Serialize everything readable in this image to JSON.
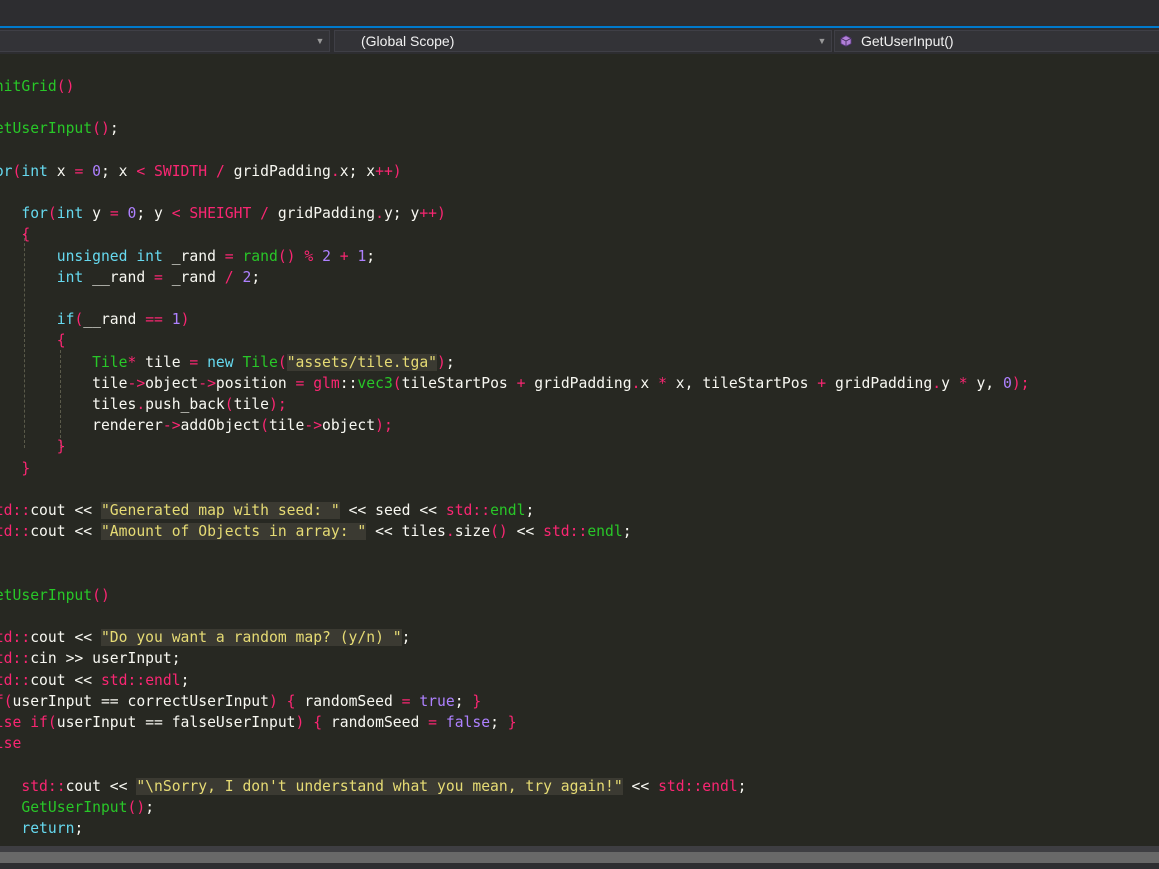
{
  "navigation": {
    "project_dropdown": "",
    "scope_dropdown": "(Global Scope)",
    "member_dropdown": "GetUserInput()",
    "member_icon": "method-cube-icon",
    "accent_color": "#007acc"
  },
  "syntax_colors": {
    "background": "#272822",
    "keyword": "#66d9ef",
    "function": "#28c728",
    "number": "#ae81ff",
    "operator": "#f92672",
    "string": "#e6db74",
    "default": "#f8f8f2"
  },
  "code": [
    {
      "tokens": [
        {
          "t": "InitGrid",
          "c": "f"
        },
        {
          "t": "()",
          "c": "o"
        }
      ]
    },
    {
      "tokens": []
    },
    {
      "tokens": [
        {
          "t": "GetUserInput",
          "c": "f"
        },
        {
          "t": "()",
          "c": "o"
        },
        {
          "t": ";",
          "c": ""
        }
      ]
    },
    {
      "tokens": []
    },
    {
      "tokens": [
        {
          "t": "for",
          "c": "k"
        },
        {
          "t": "(",
          "c": "o"
        },
        {
          "t": "int",
          "c": "k"
        },
        {
          "t": " x ",
          "c": ""
        },
        {
          "t": "=",
          "c": "o"
        },
        {
          "t": " ",
          "c": ""
        },
        {
          "t": "0",
          "c": "n"
        },
        {
          "t": "; x ",
          "c": ""
        },
        {
          "t": "<",
          "c": "o"
        },
        {
          "t": " ",
          "c": ""
        },
        {
          "t": "SWIDTH",
          "c": "o"
        },
        {
          "t": " ",
          "c": ""
        },
        {
          "t": "/",
          "c": "o"
        },
        {
          "t": " gridPadding",
          "c": ""
        },
        {
          "t": ".",
          "c": "o"
        },
        {
          "t": "x; x",
          "c": ""
        },
        {
          "t": "++)",
          "c": "o"
        }
      ]
    },
    {
      "tokens": []
    },
    {
      "tokens": [
        {
          "t": "    ",
          "c": ""
        },
        {
          "t": "for",
          "c": "k"
        },
        {
          "t": "(",
          "c": "o"
        },
        {
          "t": "int",
          "c": "k"
        },
        {
          "t": " y ",
          "c": ""
        },
        {
          "t": "=",
          "c": "o"
        },
        {
          "t": " ",
          "c": ""
        },
        {
          "t": "0",
          "c": "n"
        },
        {
          "t": "; y ",
          "c": ""
        },
        {
          "t": "<",
          "c": "o"
        },
        {
          "t": " ",
          "c": ""
        },
        {
          "t": "SHEIGHT",
          "c": "o"
        },
        {
          "t": " ",
          "c": ""
        },
        {
          "t": "/",
          "c": "o"
        },
        {
          "t": " gridPadding",
          "c": ""
        },
        {
          "t": ".",
          "c": "o"
        },
        {
          "t": "y; y",
          "c": ""
        },
        {
          "t": "++)",
          "c": "o"
        }
      ]
    },
    {
      "tokens": [
        {
          "t": "    ",
          "c": ""
        },
        {
          "t": "{",
          "c": "o"
        }
      ]
    },
    {
      "tokens": [
        {
          "t": "        ",
          "c": ""
        },
        {
          "t": "unsigned",
          "c": "k"
        },
        {
          "t": " ",
          "c": ""
        },
        {
          "t": "int",
          "c": "k"
        },
        {
          "t": " _rand ",
          "c": ""
        },
        {
          "t": "=",
          "c": "o"
        },
        {
          "t": " ",
          "c": ""
        },
        {
          "t": "rand",
          "c": "f"
        },
        {
          "t": "()",
          "c": "o"
        },
        {
          "t": " ",
          "c": ""
        },
        {
          "t": "%",
          "c": "o"
        },
        {
          "t": " ",
          "c": ""
        },
        {
          "t": "2",
          "c": "n"
        },
        {
          "t": " ",
          "c": ""
        },
        {
          "t": "+",
          "c": "o"
        },
        {
          "t": " ",
          "c": ""
        },
        {
          "t": "1",
          "c": "n"
        },
        {
          "t": ";",
          "c": ""
        }
      ]
    },
    {
      "tokens": [
        {
          "t": "        ",
          "c": ""
        },
        {
          "t": "int",
          "c": "k"
        },
        {
          "t": " __rand ",
          "c": ""
        },
        {
          "t": "=",
          "c": "o"
        },
        {
          "t": " _rand ",
          "c": ""
        },
        {
          "t": "/",
          "c": "o"
        },
        {
          "t": " ",
          "c": ""
        },
        {
          "t": "2",
          "c": "n"
        },
        {
          "t": ";",
          "c": ""
        }
      ]
    },
    {
      "tokens": []
    },
    {
      "tokens": [
        {
          "t": "        ",
          "c": ""
        },
        {
          "t": "if",
          "c": "k"
        },
        {
          "t": "(",
          "c": "o"
        },
        {
          "t": "__rand ",
          "c": ""
        },
        {
          "t": "==",
          "c": "o"
        },
        {
          "t": " ",
          "c": ""
        },
        {
          "t": "1",
          "c": "n"
        },
        {
          "t": ")",
          "c": "o"
        }
      ]
    },
    {
      "tokens": [
        {
          "t": "        ",
          "c": ""
        },
        {
          "t": "{",
          "c": "o"
        }
      ]
    },
    {
      "tokens": [
        {
          "t": "            ",
          "c": ""
        },
        {
          "t": "Tile",
          "c": "f"
        },
        {
          "t": "*",
          "c": "o"
        },
        {
          "t": " tile ",
          "c": ""
        },
        {
          "t": "=",
          "c": "o"
        },
        {
          "t": " ",
          "c": ""
        },
        {
          "t": "new",
          "c": "k"
        },
        {
          "t": " ",
          "c": ""
        },
        {
          "t": "Tile",
          "c": "f"
        },
        {
          "t": "(",
          "c": "o"
        },
        {
          "t": "\"assets/tile.tga\"",
          "c": "s"
        },
        {
          "t": ")",
          "c": "o"
        },
        {
          "t": ";",
          "c": ""
        }
      ]
    },
    {
      "tokens": [
        {
          "t": "            tile",
          "c": ""
        },
        {
          "t": "->",
          "c": "o"
        },
        {
          "t": "object",
          "c": ""
        },
        {
          "t": "->",
          "c": "o"
        },
        {
          "t": "position ",
          "c": ""
        },
        {
          "t": "=",
          "c": "o"
        },
        {
          "t": " ",
          "c": ""
        },
        {
          "t": "glm",
          "c": "o"
        },
        {
          "t": "::",
          "c": ""
        },
        {
          "t": "vec3",
          "c": "f"
        },
        {
          "t": "(",
          "c": "o"
        },
        {
          "t": "tileStartPos ",
          "c": ""
        },
        {
          "t": "+",
          "c": "o"
        },
        {
          "t": " gridPadding",
          "c": ""
        },
        {
          "t": ".",
          "c": "o"
        },
        {
          "t": "x ",
          "c": ""
        },
        {
          "t": "*",
          "c": "o"
        },
        {
          "t": " x, tileStartPos ",
          "c": ""
        },
        {
          "t": "+",
          "c": "o"
        },
        {
          "t": " gridPadding",
          "c": ""
        },
        {
          "t": ".",
          "c": "o"
        },
        {
          "t": "y ",
          "c": ""
        },
        {
          "t": "*",
          "c": "o"
        },
        {
          "t": " y, ",
          "c": ""
        },
        {
          "t": "0",
          "c": "n"
        },
        {
          "t": ");",
          "c": "o"
        }
      ]
    },
    {
      "tokens": [
        {
          "t": "            tiles",
          "c": ""
        },
        {
          "t": ".",
          "c": "o"
        },
        {
          "t": "push_back",
          "c": ""
        },
        {
          "t": "(",
          "c": "o"
        },
        {
          "t": "tile",
          "c": ""
        },
        {
          "t": ");",
          "c": "o"
        }
      ]
    },
    {
      "tokens": [
        {
          "t": "            renderer",
          "c": ""
        },
        {
          "t": "->",
          "c": "o"
        },
        {
          "t": "addObject",
          "c": ""
        },
        {
          "t": "(",
          "c": "o"
        },
        {
          "t": "tile",
          "c": ""
        },
        {
          "t": "->",
          "c": "o"
        },
        {
          "t": "object",
          "c": ""
        },
        {
          "t": ");",
          "c": "o"
        }
      ]
    },
    {
      "tokens": [
        {
          "t": "        ",
          "c": ""
        },
        {
          "t": "}",
          "c": "o"
        }
      ]
    },
    {
      "tokens": [
        {
          "t": "    ",
          "c": ""
        },
        {
          "t": "}",
          "c": "o"
        }
      ]
    },
    {
      "tokens": []
    },
    {
      "tokens": [
        {
          "t": "std",
          "c": "o"
        },
        {
          "t": "::",
          "c": "o"
        },
        {
          "t": "cout ",
          "c": ""
        },
        {
          "t": "<<",
          "c": ""
        },
        {
          "t": " ",
          "c": ""
        },
        {
          "t": "\"Generated map with seed: \"",
          "c": "s"
        },
        {
          "t": " << seed << ",
          "c": ""
        },
        {
          "t": "std",
          "c": "o"
        },
        {
          "t": "::",
          "c": "o"
        },
        {
          "t": "endl",
          "c": "f"
        },
        {
          "t": ";",
          "c": ""
        }
      ]
    },
    {
      "tokens": [
        {
          "t": "std",
          "c": "o"
        },
        {
          "t": "::",
          "c": "o"
        },
        {
          "t": "cout ",
          "c": ""
        },
        {
          "t": "<<",
          "c": ""
        },
        {
          "t": " ",
          "c": ""
        },
        {
          "t": "\"Amount of Objects in array: \"",
          "c": "s"
        },
        {
          "t": " << tiles",
          "c": ""
        },
        {
          "t": ".",
          "c": "o"
        },
        {
          "t": "size",
          "c": ""
        },
        {
          "t": "()",
          "c": "o"
        },
        {
          "t": " << ",
          "c": ""
        },
        {
          "t": "std",
          "c": "o"
        },
        {
          "t": "::",
          "c": "o"
        },
        {
          "t": "endl",
          "c": "f"
        },
        {
          "t": ";",
          "c": ""
        }
      ]
    },
    {
      "tokens": []
    },
    {
      "tokens": []
    },
    {
      "tokens": [
        {
          "t": "GetUserInput",
          "c": "f"
        },
        {
          "t": "()",
          "c": "o"
        }
      ]
    },
    {
      "tokens": []
    },
    {
      "tokens": [
        {
          "t": "std",
          "c": "o"
        },
        {
          "t": "::",
          "c": "o"
        },
        {
          "t": "cout ",
          "c": ""
        },
        {
          "t": "<<",
          "c": ""
        },
        {
          "t": " ",
          "c": ""
        },
        {
          "t": "\"Do you want a random map? (y/n) \"",
          "c": "s"
        },
        {
          "t": ";",
          "c": ""
        }
      ]
    },
    {
      "tokens": [
        {
          "t": "std",
          "c": "o"
        },
        {
          "t": "::",
          "c": "o"
        },
        {
          "t": "cin >> userInput;",
          "c": ""
        }
      ]
    },
    {
      "tokens": [
        {
          "t": "std",
          "c": "o"
        },
        {
          "t": "::",
          "c": "o"
        },
        {
          "t": "cout << ",
          "c": ""
        },
        {
          "t": "std",
          "c": "o"
        },
        {
          "t": "::",
          "c": "o"
        },
        {
          "t": "endl",
          "c": "o"
        },
        {
          "t": ";",
          "c": ""
        }
      ]
    },
    {
      "tokens": [
        {
          "t": "if",
          "c": "o"
        },
        {
          "t": "(",
          "c": "o"
        },
        {
          "t": "userInput ",
          "c": ""
        },
        {
          "t": "==",
          "c": ""
        },
        {
          "t": " correctUserInput",
          "c": ""
        },
        {
          "t": ")",
          "c": "o"
        },
        {
          "t": " ",
          "c": ""
        },
        {
          "t": "{",
          "c": "o"
        },
        {
          "t": " randomSeed ",
          "c": ""
        },
        {
          "t": "=",
          "c": "o"
        },
        {
          "t": " ",
          "c": ""
        },
        {
          "t": "true",
          "c": "n"
        },
        {
          "t": "; ",
          "c": ""
        },
        {
          "t": "}",
          "c": "o"
        }
      ]
    },
    {
      "tokens": [
        {
          "t": "else",
          "c": "o"
        },
        {
          "t": " ",
          "c": ""
        },
        {
          "t": "if",
          "c": "o"
        },
        {
          "t": "(",
          "c": "o"
        },
        {
          "t": "userInput ",
          "c": ""
        },
        {
          "t": "==",
          "c": ""
        },
        {
          "t": " falseUserInput",
          "c": ""
        },
        {
          "t": ")",
          "c": "o"
        },
        {
          "t": " ",
          "c": ""
        },
        {
          "t": "{",
          "c": "o"
        },
        {
          "t": " randomSeed ",
          "c": ""
        },
        {
          "t": "=",
          "c": "o"
        },
        {
          "t": " ",
          "c": ""
        },
        {
          "t": "false",
          "c": "n"
        },
        {
          "t": "; ",
          "c": ""
        },
        {
          "t": "}",
          "c": "o"
        }
      ]
    },
    {
      "tokens": [
        {
          "t": "else",
          "c": "o"
        }
      ]
    },
    {
      "tokens": []
    },
    {
      "tokens": [
        {
          "t": "    ",
          "c": ""
        },
        {
          "t": "std",
          "c": "o"
        },
        {
          "t": "::",
          "c": "o"
        },
        {
          "t": "cout << ",
          "c": ""
        },
        {
          "t": "\"\\nSorry, I don't understand what you mean, try again!\"",
          "c": "s"
        },
        {
          "t": " << ",
          "c": ""
        },
        {
          "t": "std",
          "c": "o"
        },
        {
          "t": "::",
          "c": "o"
        },
        {
          "t": "endl",
          "c": "o"
        },
        {
          "t": ";",
          "c": ""
        }
      ]
    },
    {
      "tokens": [
        {
          "t": "    ",
          "c": ""
        },
        {
          "t": "GetUserInput",
          "c": "f"
        },
        {
          "t": "()",
          "c": "o"
        },
        {
          "t": ";",
          "c": ""
        }
      ]
    },
    {
      "tokens": [
        {
          "t": "    ",
          "c": ""
        },
        {
          "t": "return",
          "c": "k"
        },
        {
          "t": ";",
          "c": ""
        }
      ]
    }
  ]
}
